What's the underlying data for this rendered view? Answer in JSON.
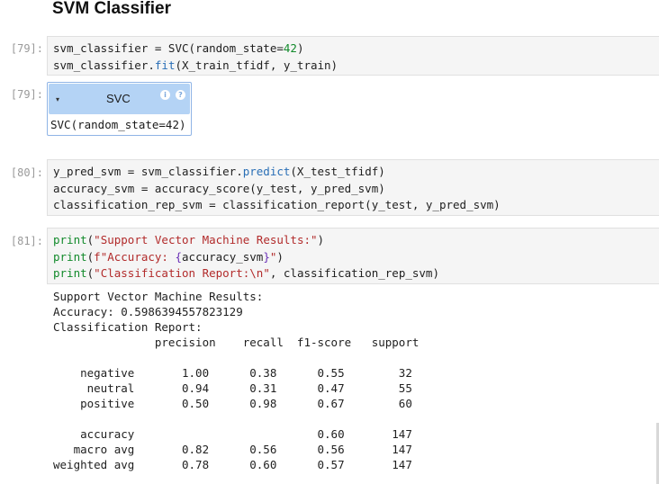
{
  "heading": "SVM Classifier",
  "cells": [
    {
      "prompt": "[79]:",
      "lines": [
        [
          {
            "t": "svm_classifier = SVC(random_state=",
            "c": "kw"
          },
          {
            "t": "42",
            "c": "num"
          },
          {
            "t": ")",
            "c": "kw"
          }
        ],
        [
          {
            "t": "svm_classifier.",
            "c": "kw"
          },
          {
            "t": "fit",
            "c": "fn"
          },
          {
            "t": "(X_train_tfidf, y_train)",
            "c": "kw"
          }
        ]
      ]
    },
    {
      "prompt": "[80]:",
      "lines": [
        [
          {
            "t": "y_pred_svm = svm_classifier.",
            "c": "kw"
          },
          {
            "t": "predict",
            "c": "fn"
          },
          {
            "t": "(X_test_tfidf)",
            "c": "kw"
          }
        ],
        [
          {
            "t": "accuracy_svm = accuracy_score(y_test, y_pred_svm)",
            "c": "kw"
          }
        ],
        [
          {
            "t": "classification_rep_svm = classification_report(y_test, y_pred_svm)",
            "c": "kw"
          }
        ]
      ]
    },
    {
      "prompt": "[81]:",
      "lines": [
        [
          {
            "t": "print",
            "c": "num"
          },
          {
            "t": "(",
            "c": "kw"
          },
          {
            "t": "\"Support Vector Machine Results:\"",
            "c": "str"
          },
          {
            "t": ")",
            "c": "kw"
          }
        ],
        [
          {
            "t": "print",
            "c": "num"
          },
          {
            "t": "(",
            "c": "kw"
          },
          {
            "t": "f\"Accuracy: ",
            "c": "str"
          },
          {
            "t": "{",
            "c": "op"
          },
          {
            "t": "accuracy_svm",
            "c": "interp"
          },
          {
            "t": "}",
            "c": "op"
          },
          {
            "t": "\"",
            "c": "str"
          },
          {
            "t": ")",
            "c": "kw"
          }
        ],
        [
          {
            "t": "print",
            "c": "num"
          },
          {
            "t": "(",
            "c": "kw"
          },
          {
            "t": "\"Classification Report:\\n\"",
            "c": "str"
          },
          {
            "t": ", classification_rep_svm)",
            "c": "kw"
          }
        ]
      ]
    }
  ],
  "svc_output": {
    "prompt": "[79]:",
    "caret": "▾",
    "title": "SVC",
    "icon_info": "i",
    "icon_help": "?",
    "params": "SVC(random_state=42)"
  },
  "output_lines": [
    "Support Vector Machine Results:",
    "Accuracy: 0.5986394557823129",
    "Classification Report:",
    "               precision    recall  f1-score   support",
    "",
    "    negative       1.00      0.38      0.55        32",
    "     neutral       0.94      0.31      0.47        55",
    "    positive       0.50      0.98      0.67        60",
    "",
    "    accuracy                           0.60       147",
    "   macro avg       0.82      0.56      0.56       147",
    "weighted avg       0.78      0.60      0.57       147"
  ]
}
